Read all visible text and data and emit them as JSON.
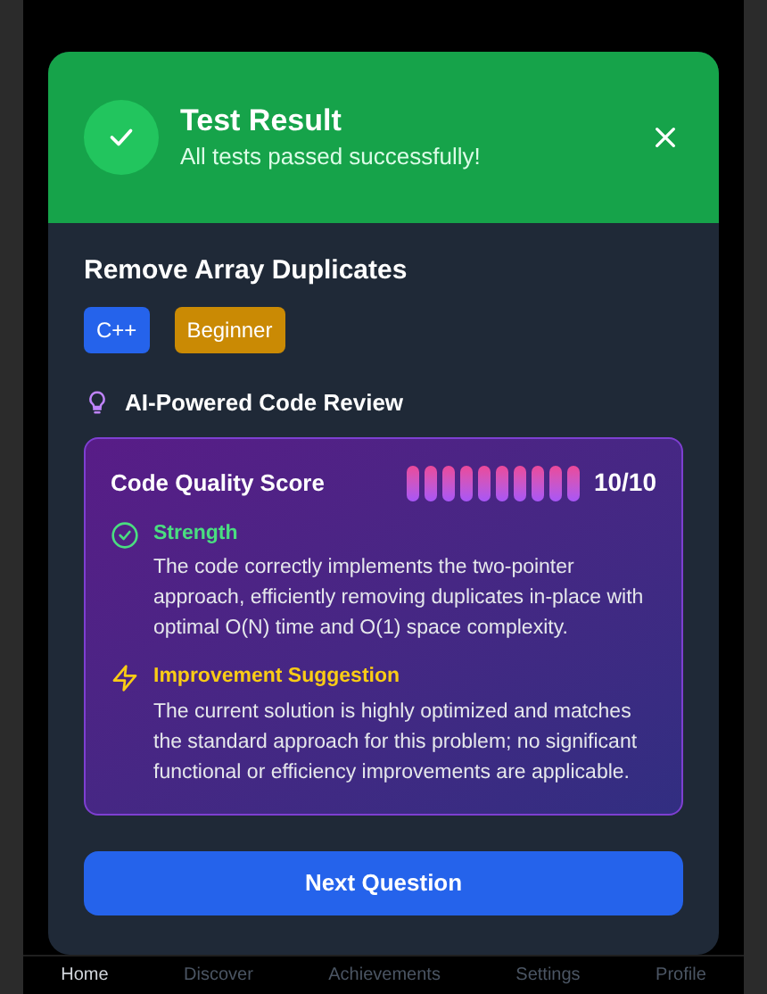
{
  "result": {
    "title": "Test Result",
    "message": "All tests passed successfully!",
    "passed": true
  },
  "problem": {
    "title": "Remove Array Duplicates",
    "tags": [
      {
        "label": "C++",
        "color": "#2563eb"
      },
      {
        "label": "Beginner",
        "color": "#ca8a04"
      }
    ]
  },
  "review": {
    "heading": "AI-Powered Code Review",
    "score_label": "Code Quality Score",
    "level": 1,
    "score": "10/10",
    "sections": [
      {
        "kind": "strength",
        "title": "Strength",
        "text": "The code correctly implements the two-pointer approach, efficiently removing duplicates in-place with optimal O(N) time and O(1) space complexity."
      },
      {
        "kind": "suggestion",
        "title": "Improvement Suggestion",
        "text": "The current solution is highly optimized and matches the standard approach for this problem; no significant functional or efficiency improvements are applicable."
      }
    ]
  },
  "next_button": "Next Question",
  "nav": [
    {
      "label": "Home",
      "selected": true
    },
    {
      "label": "Discover",
      "selected": false
    },
    {
      "label": "Achievements",
      "selected": false
    },
    {
      "label": "Settings",
      "selected": false
    },
    {
      "label": "Profile",
      "selected": false
    }
  ]
}
